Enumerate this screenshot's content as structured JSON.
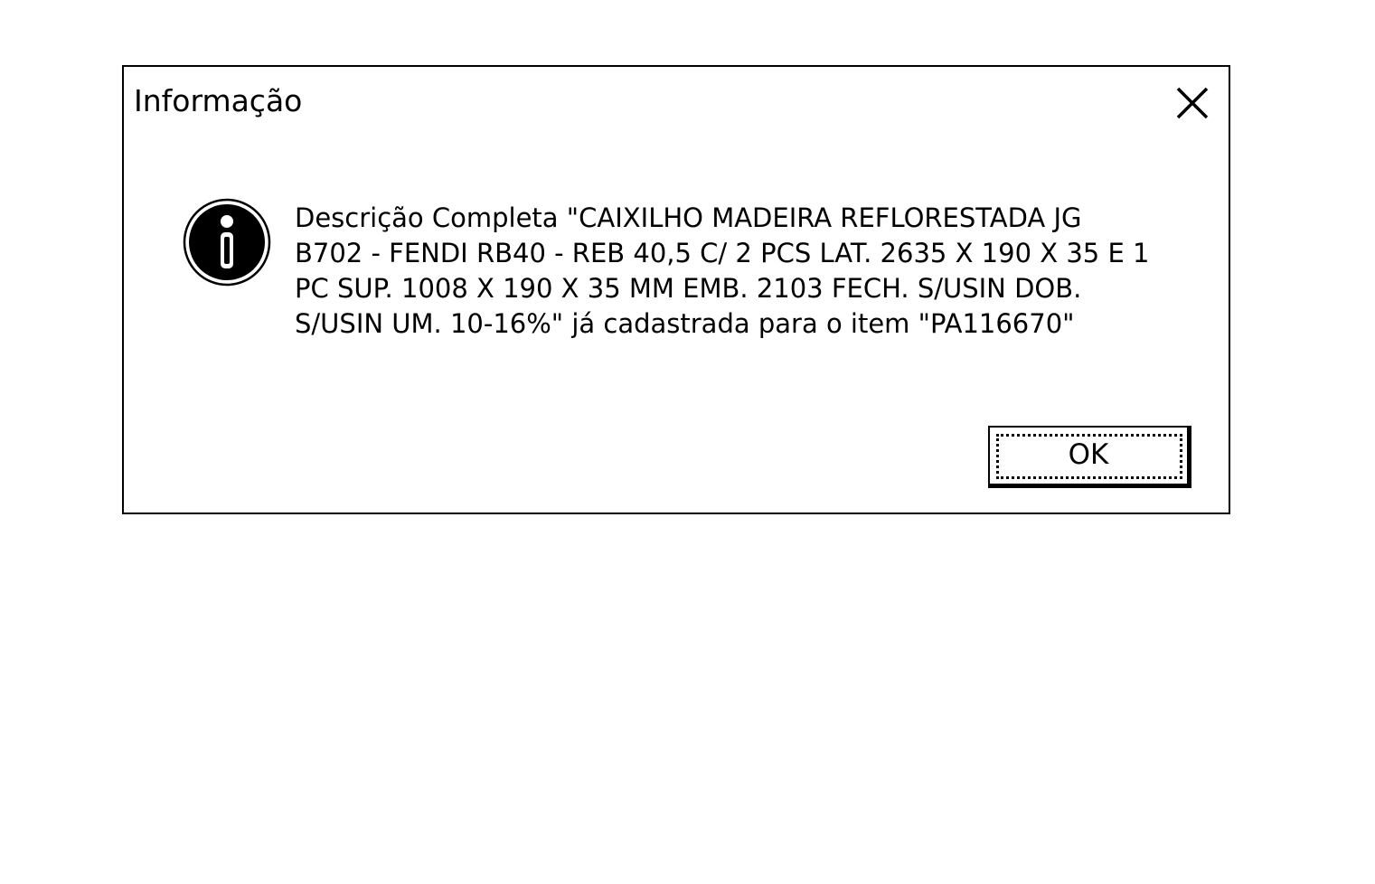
{
  "dialog": {
    "title": "Informação",
    "close_icon": "close-icon",
    "status_icon": "info-icon",
    "message_lines": [
      "Descrição Completa \"CAIXILHO MADEIRA REFLORESTADA JG",
      "B702 - FENDI RB40 - REB 40,5 C/ 2 PCS LAT. 2635 X 190 X 35 E 1",
      "PC SUP. 1008 X 190 X 35 MM EMB. 2103 FECH. S/USIN DOB.",
      "S/USIN UM. 10-16%\" já cadastrada para o item \"PA116670\""
    ],
    "ok_label": "OK"
  }
}
